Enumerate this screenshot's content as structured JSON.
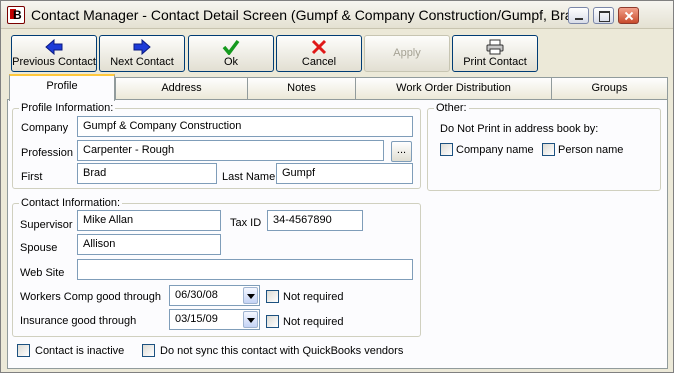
{
  "window": {
    "title": "Contact Manager - Contact Detail Screen (Gumpf & Company Construction/Gumpf, Brad)"
  },
  "toolbar": {
    "previous_contact": "Previous Contact",
    "next_contact": "Next Contact",
    "ok": "Ok",
    "cancel": "Cancel",
    "apply": "Apply",
    "print_contact": "Print Contact"
  },
  "tabs": [
    "Profile",
    "Address",
    "Notes",
    "Work Order Distribution",
    "Groups"
  ],
  "profile_info": {
    "title": "Profile Information:",
    "company_label": "Company",
    "company_value": "Gumpf & Company Construction",
    "profession_label": "Profession",
    "profession_value": "Carpenter - Rough",
    "browse_label": "...",
    "first_label": "First",
    "first_value": "Brad",
    "last_label": "Last Name",
    "last_value": "Gumpf"
  },
  "other": {
    "title": "Other:",
    "do_not_print": "Do Not Print in address book by:",
    "company_name": "Company name",
    "person_name": "Person name"
  },
  "contact_info": {
    "title": "Contact Information:",
    "supervisor_label": "Supervisor",
    "supervisor_value": "Mike Allan",
    "taxid_label": "Tax ID",
    "taxid_value": "34-4567890",
    "spouse_label": "Spouse",
    "spouse_value": "Allison",
    "website_label": "Web Site",
    "website_value": "",
    "workers_comp_label": "Workers Comp good through",
    "workers_comp_value": "06/30/08",
    "insurance_label": "Insurance good through",
    "insurance_value": "03/15/09",
    "not_required": "Not required"
  },
  "footer": {
    "inactive": "Contact is inactive",
    "no_sync": "Do not sync this contact with QuickBooks vendors"
  }
}
